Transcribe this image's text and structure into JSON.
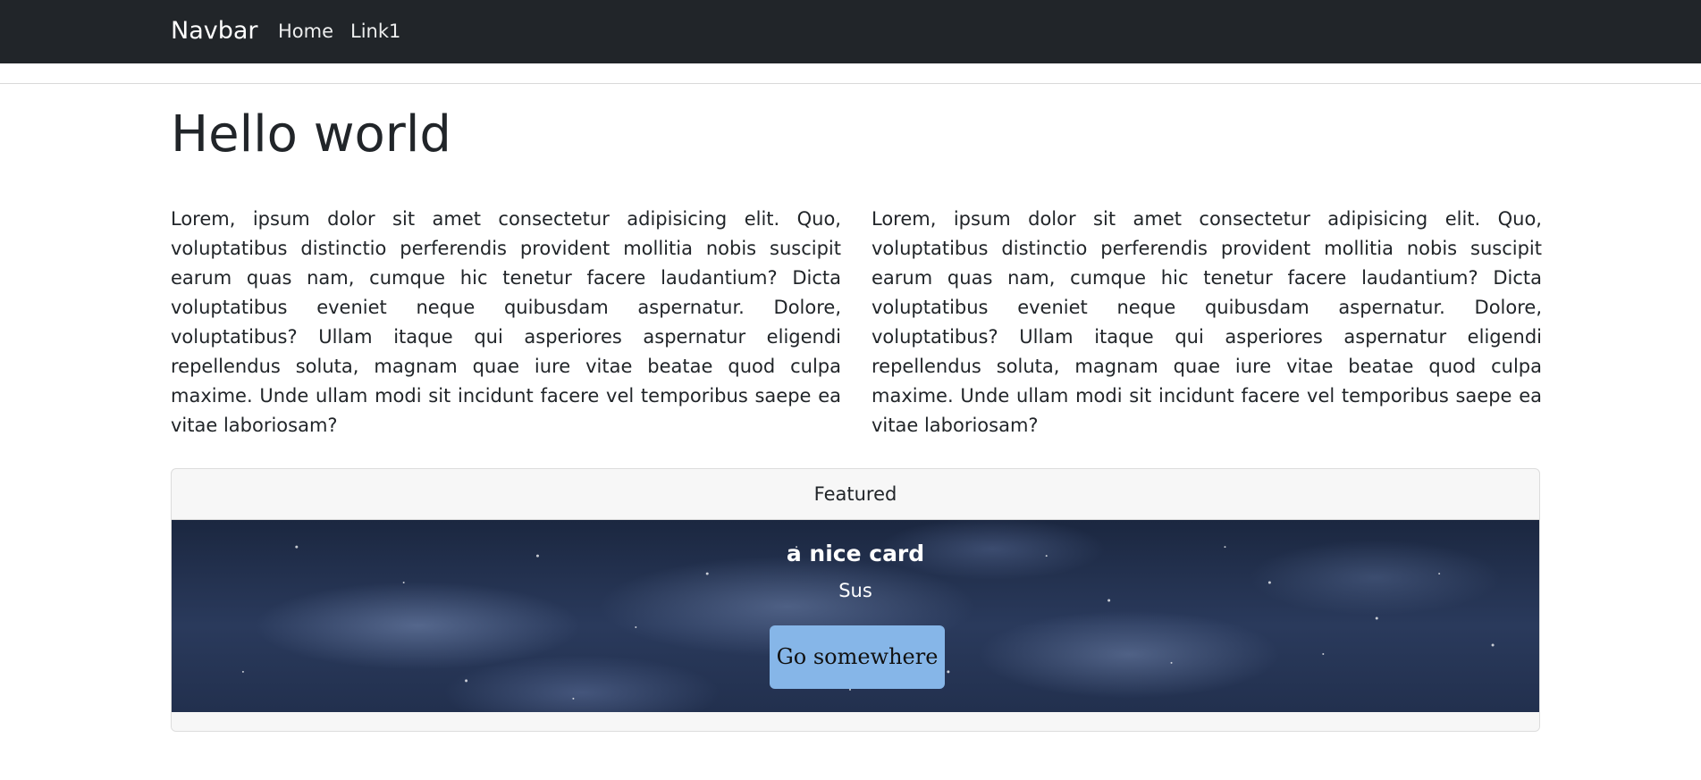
{
  "navbar": {
    "brand": "Navbar",
    "links": [
      {
        "label": "Home"
      },
      {
        "label": "Link1"
      }
    ]
  },
  "main": {
    "title": "Hello world",
    "paragraphs": [
      "Lorem, ipsum dolor sit amet consectetur adipisicing elit. Quo, voluptatibus distinctio perferendis provident mollitia nobis suscipit earum quas nam, cumque hic tenetur facere laudantium? Dicta voluptatibus eveniet neque quibusdam aspernatur. Dolore, voluptatibus? Ullam itaque qui asperiores aspernatur eligendi repellendus soluta, magnam quae iure vitae beatae quod culpa maxime. Unde ullam modi sit incidunt facere vel temporibus saepe ea vitae laboriosam?",
      "Lorem, ipsum dolor sit amet consectetur adipisicing elit. Quo, voluptatibus distinctio perferendis provident mollitia nobis suscipit earum quas nam, cumque hic tenetur facere laudantium? Dicta voluptatibus eveniet neque quibusdam aspernatur. Dolore, voluptatibus? Ullam itaque qui asperiores aspernatur eligendi repellendus soluta, magnam quae iure vitae beatae quod culpa maxime. Unde ullam modi sit incidunt facere vel temporibus saepe ea vitae laboriosam?"
    ]
  },
  "card": {
    "header": "Featured",
    "title": "a nice card",
    "text": "Sus",
    "button_label": "Go somewhere"
  },
  "colors": {
    "navbar_bg": "#212529",
    "button_bg": "#86b6e8",
    "card_bg": "#f7f7f7"
  }
}
